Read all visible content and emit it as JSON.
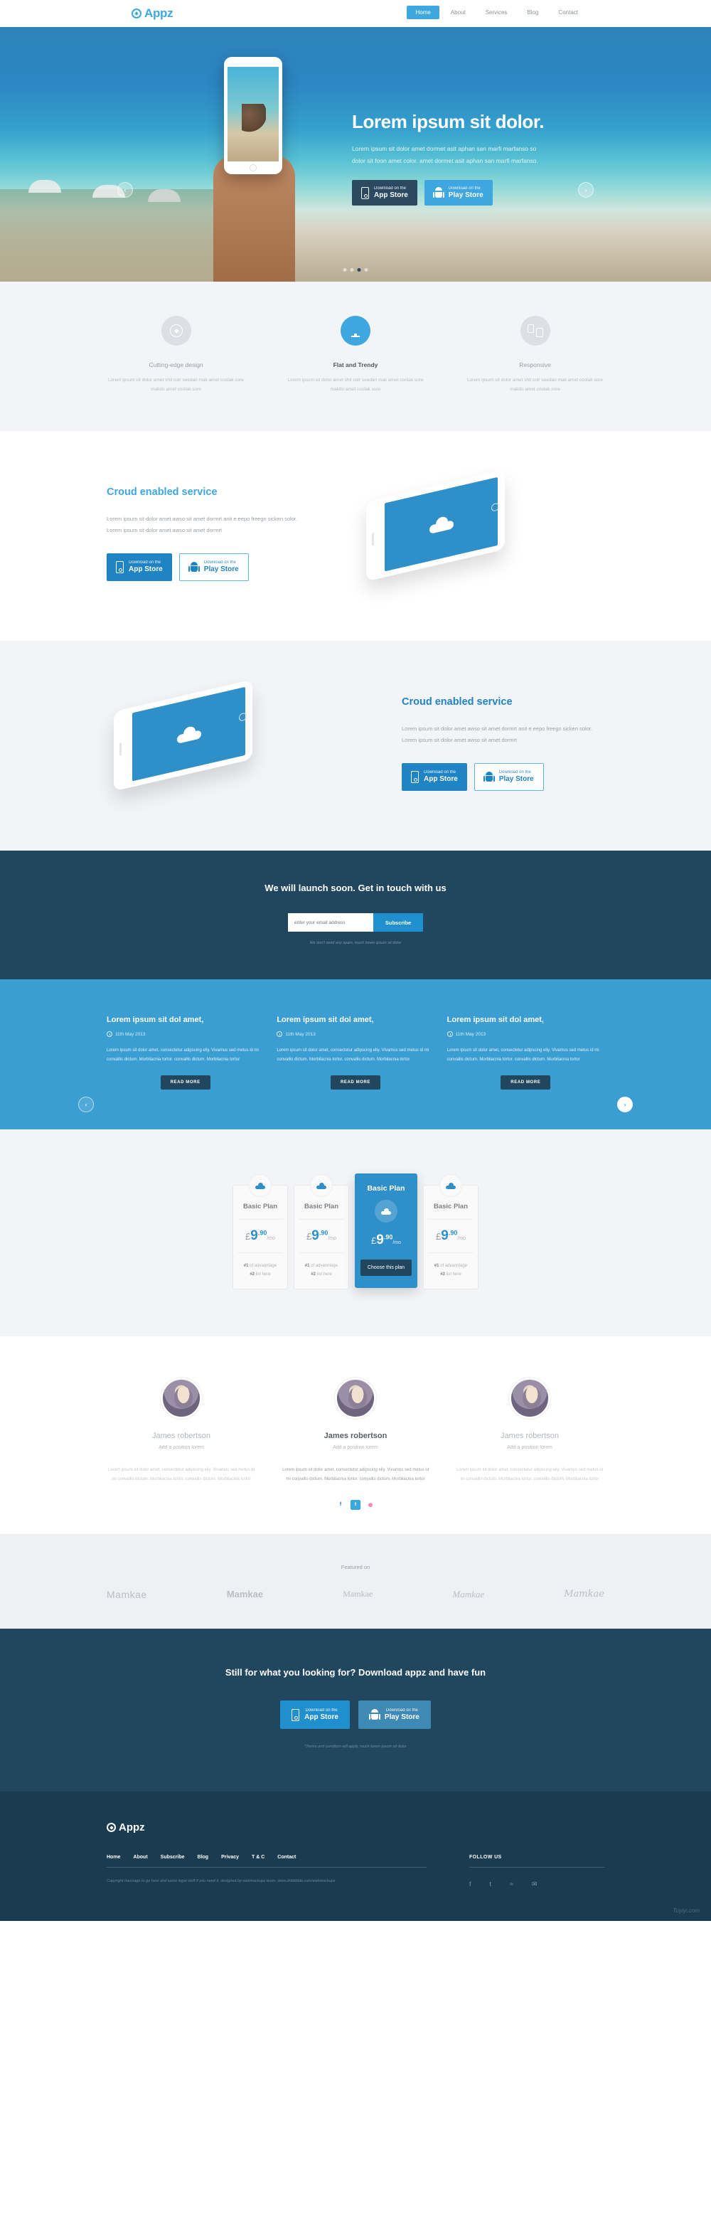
{
  "brand": {
    "name": "Appz",
    "icon": "compass-icon",
    "accent": "#3ea7e0",
    "dark": "#21475f"
  },
  "nav": {
    "items": [
      {
        "label": "Home",
        "active": true
      },
      {
        "label": "About",
        "active": false
      },
      {
        "label": "Services",
        "active": false
      },
      {
        "label": "Blog",
        "active": false
      },
      {
        "label": "Contact",
        "active": false
      }
    ]
  },
  "hero": {
    "title": "Lorem ipsum sit dolor.",
    "paragraph": "Lorem ipsum sit dolor amet dormet asit aphan san marfi marfanso so dolor sit foon amet color. amet dormet asit aphan san marfi marfanso.",
    "app_store": {
      "small": "Download on the",
      "big": "App Store"
    },
    "play_store": {
      "small": "Download on the",
      "big": "Play Store"
    },
    "prev_arrow": "‹",
    "next_arrow": "›",
    "dots": [
      false,
      false,
      true,
      false
    ]
  },
  "features": {
    "items": [
      {
        "icon": "compass-icon",
        "title": "Cutting-edge design",
        "text": "Lorem ipsum sit dolor amet shit colr seedan mak amet coolak sore makdo amet coolak sore",
        "active": false
      },
      {
        "icon": "monitor-icon",
        "title": "Flat and Trendy",
        "text": "Lorem ipsum sit dolor amet shit colr seedan mak amet coolak sore makdo amet coolak sore",
        "active": true
      },
      {
        "icon": "responsive-devices-icon",
        "title": "Responsive",
        "text": "Lorem ipsum sit dolor amet shit colr seedan mak amet coolak sore makdo amet coolak sore",
        "active": false
      }
    ]
  },
  "cloud_left": {
    "title": "Croud enabled service",
    "text": "Lorem ipsum sit dolor amet awso sit amet dormrt anit e eepo freegn sicken solor. Lorem ipsum sit dolor amet awso sit amet dormrt",
    "app_store": {
      "small": "Download on the",
      "big": "App Store"
    },
    "play_store": {
      "small": "Download on the",
      "big": "Play Store"
    }
  },
  "cloud_right": {
    "title": "Croud enabled service",
    "text": "Lorem ipsum sit dolor amet awso sit amet dormrt anit e eepo freegn sicken solor. Lorem ipsum sit dolor amet awso sit amet dormrt",
    "app_store": {
      "small": "Download on the",
      "big": "App Store"
    },
    "play_store": {
      "small": "Download on the",
      "big": "Play Store"
    }
  },
  "newsletter": {
    "title": "We will launch soon. Get in touch with us",
    "placeholder": "enter your email address",
    "button": "Subscribe",
    "note": "We don't send any spam, much lorem ipsum sit dolor"
  },
  "blog": {
    "prev_arrow": "‹",
    "next_arrow": "›",
    "posts": [
      {
        "title": "Lorem ipsum sit dol amet,",
        "date": "11th May 2013",
        "text": "Lorem ipsum sit dolor amet, consectetur adipscing eliy. Vivamus sed metus id mi convallis dictum. Morbilacnia tortor. convallis dictum. Morbilacnia tortor",
        "button": "READ MORE"
      },
      {
        "title": "Lorem ipsum sit dol amet,",
        "date": "11th May 2013",
        "text": "Lorem ipsum sit dolor amet, consectetur adipscing eliy. Vivamus sed metus id mi convallis dictum. Morbilacnia tortor. convallis dictum. Morbilacnia tortor",
        "button": "READ MORE"
      },
      {
        "title": "Lorem ipsum sit dol amet,",
        "date": "11th May 2013",
        "text": "Lorem ipsum sit dolor amet, consectetur adipscing eliy. Vivamus sed metus id mi convallis dictum. Morbilacnia tortor. convallis dictum. Morbilacnia tortor",
        "button": "READ MORE"
      }
    ]
  },
  "pricing": {
    "plans": [
      {
        "name": "Basic Plan",
        "currency": "£",
        "amount": "9",
        "decimal": ".90",
        "period": "/mo",
        "f1_num": "#1",
        "f1_text": " of advanntage",
        "f2_num": "#2",
        "f2_text": " list here",
        "featured": false,
        "cta": ""
      },
      {
        "name": "Basic Plan",
        "currency": "£",
        "amount": "9",
        "decimal": ".90",
        "period": "/mo",
        "f1_num": "#1",
        "f1_text": " of advanntage",
        "f2_num": "#2",
        "f2_text": " list here",
        "featured": false,
        "cta": ""
      },
      {
        "name": "Basic Plan",
        "currency": "£",
        "amount": "9",
        "decimal": ".90",
        "period": "/mo",
        "f1_num": "",
        "f1_text": "",
        "f2_num": "",
        "f2_text": "",
        "featured": true,
        "cta": "Choose this plan"
      },
      {
        "name": "Basic Plan",
        "currency": "£",
        "amount": "9",
        "decimal": ".90",
        "period": "/mo",
        "f1_num": "#1",
        "f1_text": " of advanntage",
        "f2_num": "#2",
        "f2_text": " list here",
        "featured": false,
        "cta": ""
      }
    ]
  },
  "team": {
    "members": [
      {
        "name": "James robertson",
        "position": "Add a position lorem",
        "text": "Lorem ipsum sit dolor amet, consectetur adipscing eliy. Vivamus sed metus id mi convallis dictum. Morbilacnia tortor. convallis dictum. Morbilacnia tortor",
        "active": false
      },
      {
        "name": "James robertson",
        "position": "Add a position lorem",
        "text": "Lorem ipsum sit dolor amet, consectetur adipscing eliy. Vivamus sed metus id mi convallis dictum. Morbilacnia tortor. convallis dictum. Morbilacnia tortor",
        "active": true
      },
      {
        "name": "James robertson",
        "position": "Add a position lorem",
        "text": "Lorem ipsum sit dolor amet, consectetur adipscing eliy. Vivamus sed metus id mi convallis dictum. Morbilacnia tortor. convallis dictum. Morbilacnia tortor",
        "active": false
      }
    ],
    "socials": [
      {
        "icon": "facebook-icon",
        "glyph": "f"
      },
      {
        "icon": "twitter-icon",
        "glyph": "t"
      },
      {
        "icon": "dribbble-icon",
        "glyph": "◍"
      }
    ]
  },
  "featured_on": {
    "label": "Featured on",
    "logos": [
      "Mamkae",
      "Mamkae",
      "Mamkae",
      "Mamkae",
      "Mamkae"
    ]
  },
  "cta": {
    "title": "Still for what you looking for? Download appz and have fun",
    "app_store": {
      "small": "Download on the",
      "big": "App Store"
    },
    "play_store": {
      "small": "Download on the",
      "big": "Play Store"
    },
    "note": "*Terms and condition will apply, much lorem ipsum sit dolor"
  },
  "footer": {
    "brand": "Appz",
    "links": [
      "Home",
      "About",
      "Subscribe",
      "Blog",
      "Privacy",
      "T & C",
      "Contact"
    ],
    "copyright": "Copyright message to go here and some legal stuff if you need it. designed by webmockupz team. www.dribbbble.com/webmockupz",
    "follow_title": "FOLLOW US",
    "socials": [
      {
        "icon": "facebook-icon",
        "glyph": "f"
      },
      {
        "icon": "twitter-icon",
        "glyph": "t"
      },
      {
        "icon": "rss-icon",
        "glyph": "≈"
      },
      {
        "icon": "mail-icon",
        "glyph": "✉"
      }
    ]
  },
  "watermark": "Tuyiyi.com"
}
